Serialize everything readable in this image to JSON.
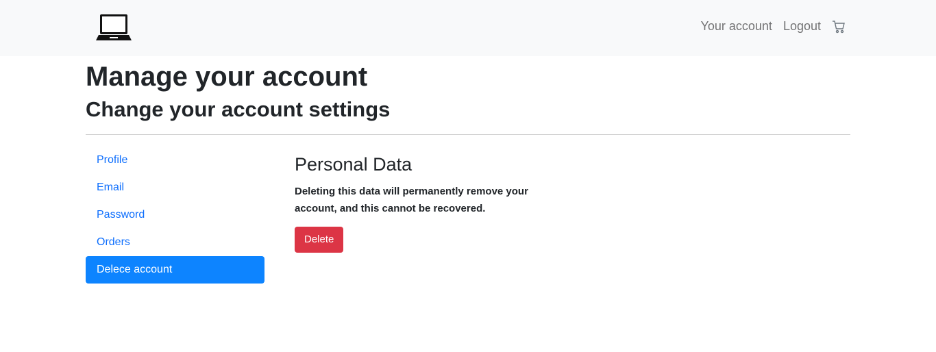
{
  "header": {
    "logo_icon": "laptop-icon",
    "links": {
      "account": "Your account",
      "logout": "Logout"
    },
    "cart_icon": "cart-icon"
  },
  "page": {
    "title": "Manage your account",
    "subtitle": "Change your account settings"
  },
  "sidebar": {
    "items": [
      {
        "label": "Profile"
      },
      {
        "label": "Email"
      },
      {
        "label": "Password"
      },
      {
        "label": "Orders"
      },
      {
        "label": "Delece account"
      }
    ],
    "active_index": 4,
    "active_color": "#0d84ff",
    "link_color": "#0d6efd"
  },
  "content": {
    "heading": "Personal Data",
    "warning": "Deleting this data will permanently remove your account, and this cannot be recovered.",
    "delete_button": "Delete",
    "delete_color": "#dc3545"
  }
}
